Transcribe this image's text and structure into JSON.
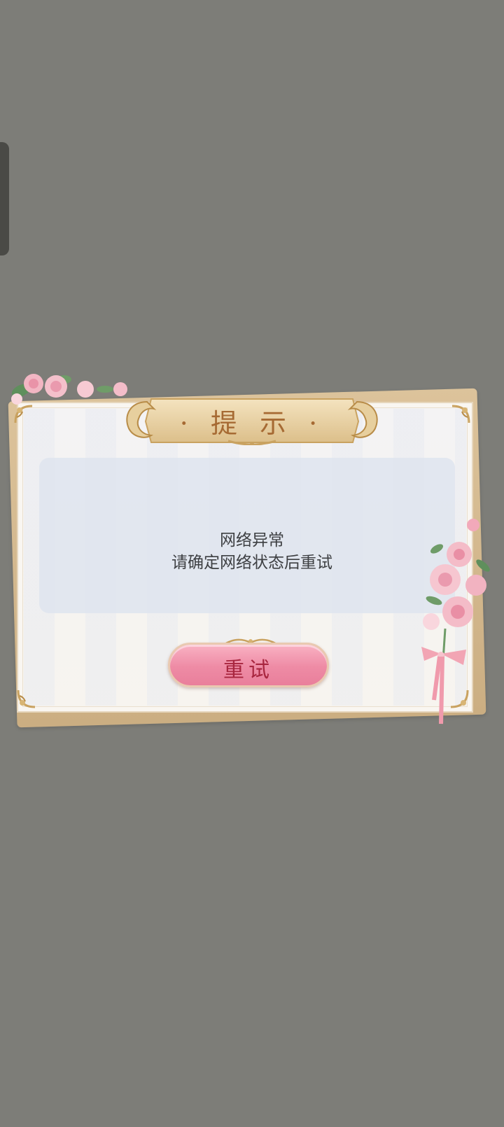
{
  "dialog": {
    "title": "· 提 示 ·",
    "message_line1": "网络异常",
    "message_line2": "请确定网络状态后重试",
    "retry_label": "重试"
  },
  "colors": {
    "background": "#7d7d78",
    "card_gold": "#cbae82",
    "title_text": "#a66a33",
    "button_pink": "#ee8ba5",
    "button_text": "#a8263f"
  },
  "icons": [
    "corner-ornament-icon",
    "wing-ornament-icon",
    "rose-decoration-icon",
    "ribbon-bow-icon"
  ]
}
